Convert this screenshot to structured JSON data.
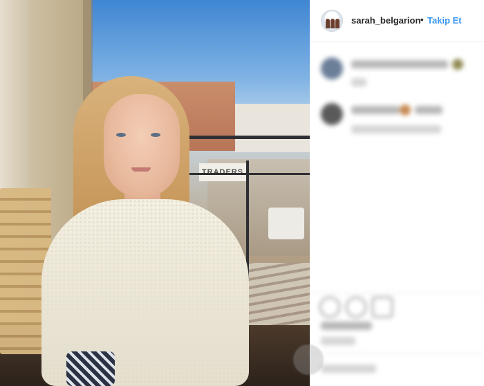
{
  "post": {
    "header": {
      "username": "sarah_belgarion",
      "separator": "•",
      "follow_label": "Takip Et"
    },
    "photo": {
      "sign_text": "TRADERS"
    },
    "comments": [
      {
        "avatar_color": "#6c7f99"
      },
      {
        "avatar_color": "#5a5a5a"
      }
    ],
    "action_icons": [
      "heart-icon",
      "comment-icon",
      "share-icon"
    ],
    "colors": {
      "link_blue": "#3897f0",
      "text_dark": "#262626",
      "divider": "#efefef"
    }
  }
}
